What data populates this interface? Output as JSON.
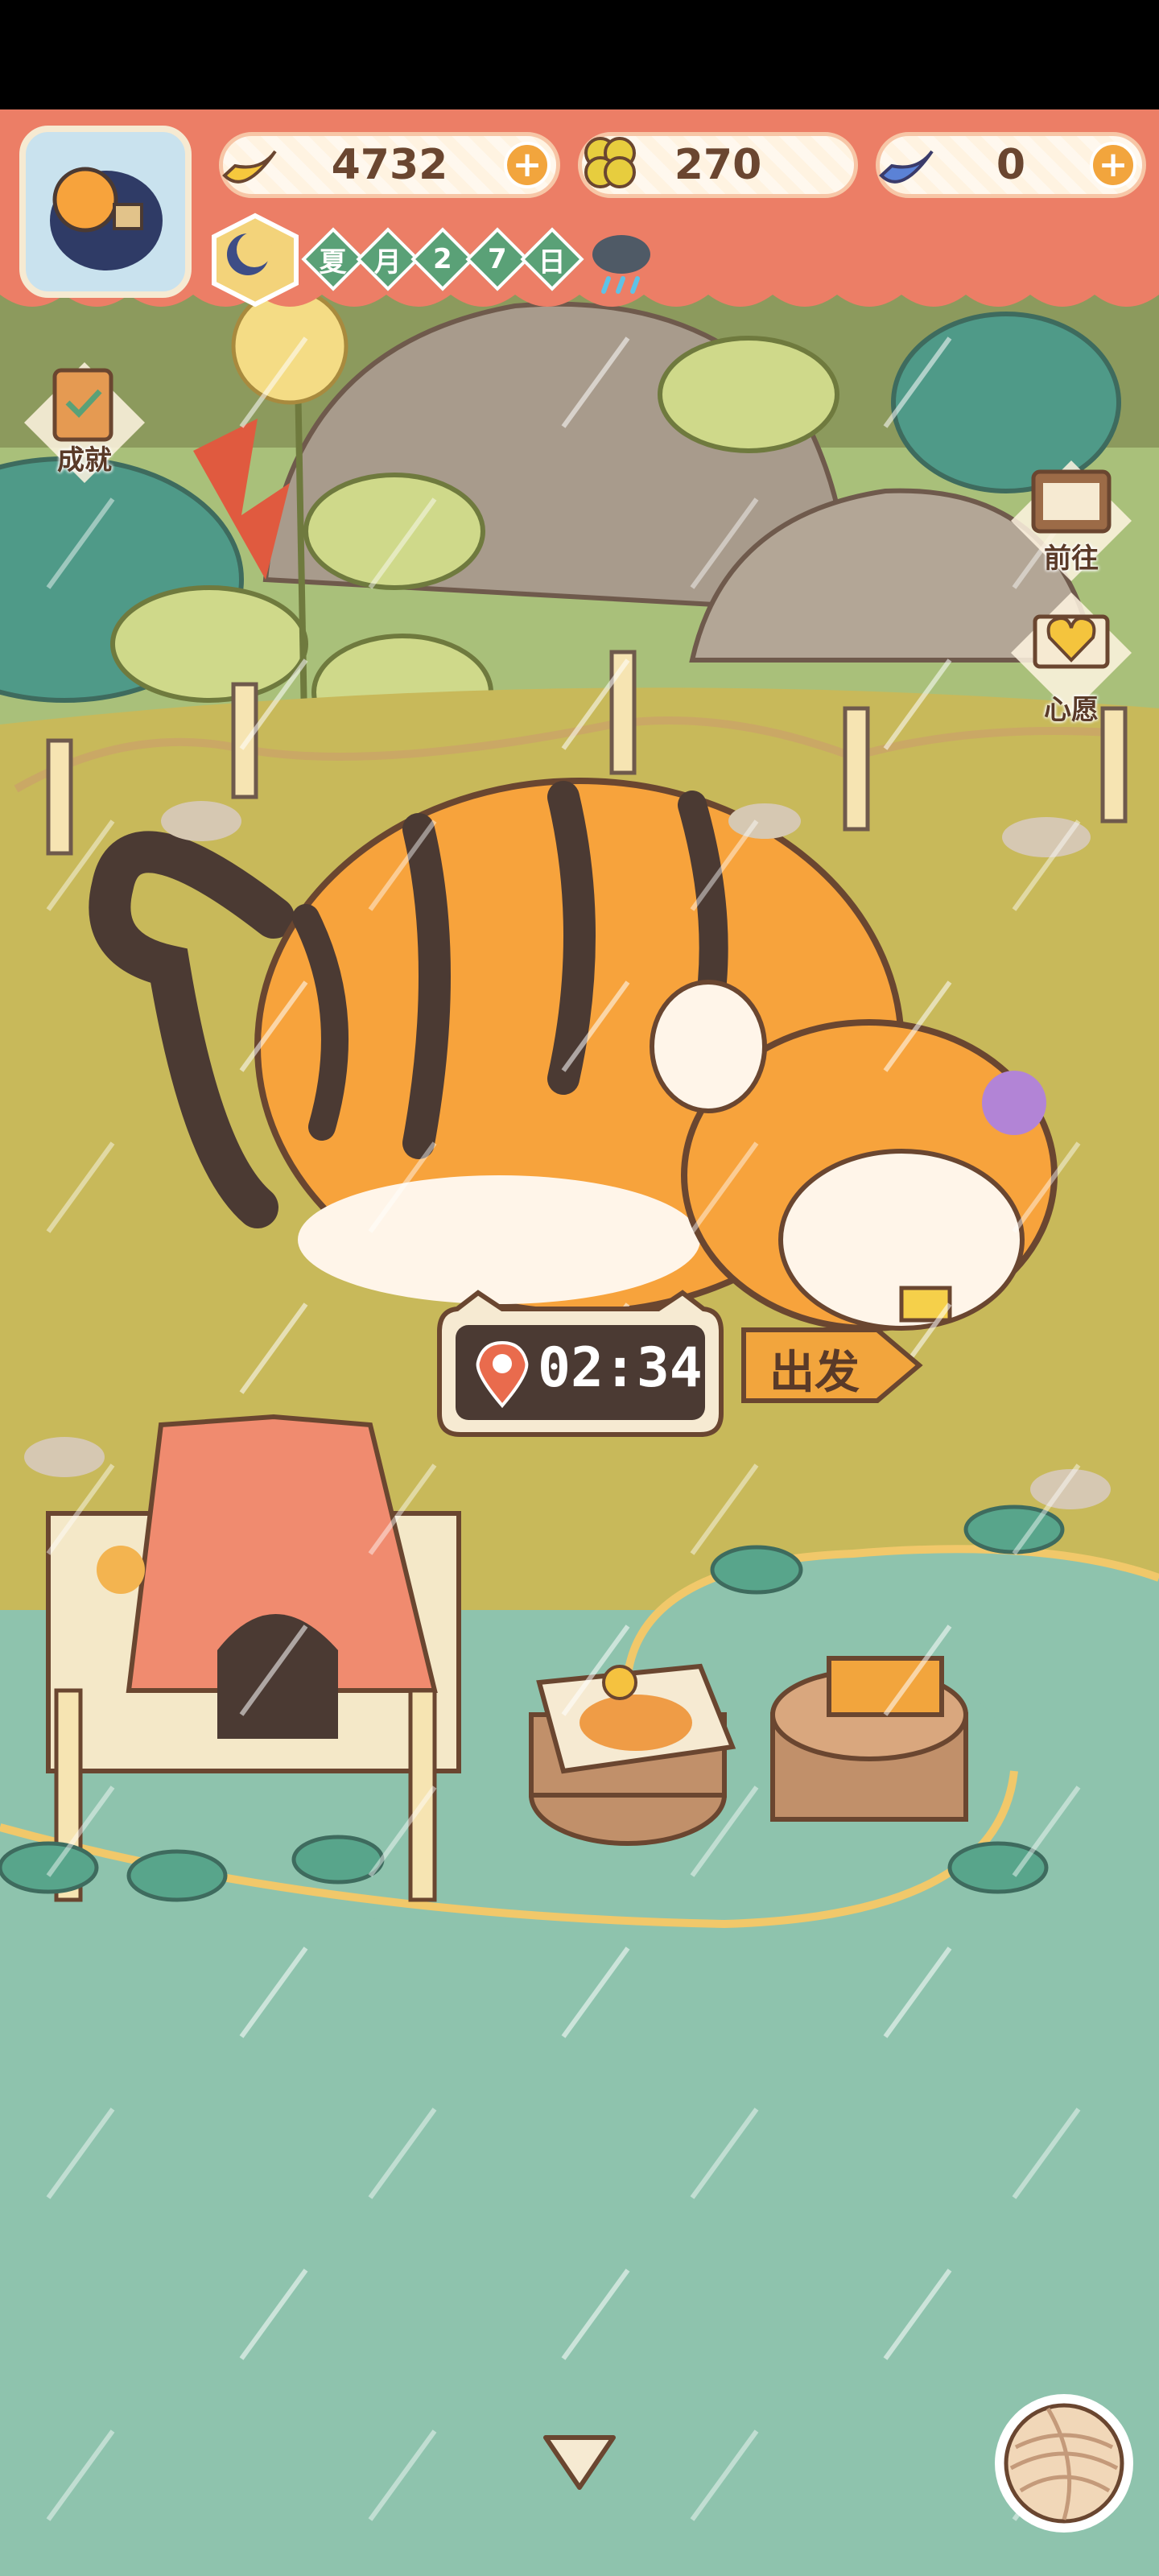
{
  "hud": {
    "currencies": [
      {
        "name": "banana",
        "value": "4732",
        "has_plus": true
      },
      {
        "name": "clover",
        "value": "270",
        "has_plus": false
      },
      {
        "name": "blue-banana",
        "value": "0",
        "has_plus": true
      }
    ],
    "date": {
      "season": "夏",
      "month_label": "月",
      "digit1": "2",
      "digit2": "7",
      "day_label": "日"
    },
    "weather_icon": "rain-cloud-icon"
  },
  "side_buttons": {
    "achievement": "成就",
    "go": "前往",
    "wish": "心愿"
  },
  "timer": {
    "time": "02:34"
  },
  "depart_sign": {
    "label": "出发"
  },
  "icons": {
    "avatar": "tiger-avatar",
    "achievement": "clipboard-icon",
    "go": "signboard-icon",
    "wish": "heart-book-icon",
    "yarn": "yarn-ball-icon",
    "collapse": "triangle-down-icon"
  },
  "colors": {
    "header": "#ec7e66",
    "grass": "#c8b95a",
    "water": "#8ec3ad",
    "tiger_orange": "#f7a33c",
    "stripe": "#4b3a33"
  }
}
